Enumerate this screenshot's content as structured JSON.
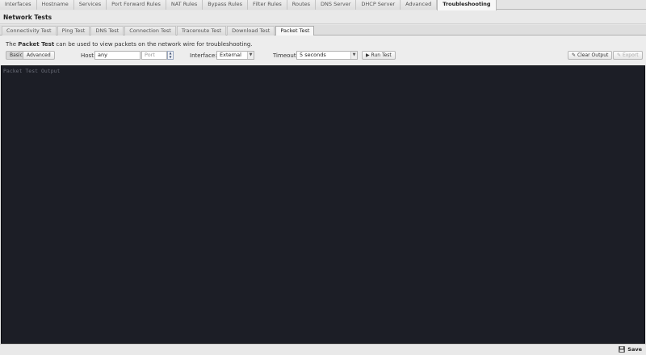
{
  "top_tabs": [
    "Interfaces",
    "Hostname",
    "Services",
    "Port Forward Rules",
    "NAT Rules",
    "Bypass Rules",
    "Filter Rules",
    "Routes",
    "DNS Server",
    "DHCP Server",
    "Advanced",
    "Troubleshooting"
  ],
  "active_top_tab": "Troubleshooting",
  "section_title": "Network Tests",
  "sub_tabs": [
    "Connectivity Test",
    "Ping Test",
    "DNS Test",
    "Connection Test",
    "Traceroute Test",
    "Download Test",
    "Packet Test"
  ],
  "active_sub_tab": "Packet Test",
  "description": {
    "prefix": "The ",
    "bold": "Packet Test",
    "suffix": " can be used to view packets on the network wire for troubleshooting."
  },
  "mode": {
    "basic": "Basic",
    "advanced": "Advanced",
    "selected": "Basic"
  },
  "host": {
    "label": "Host:",
    "value": "any",
    "port_placeholder": "Port"
  },
  "interface": {
    "label": "Interface:",
    "value": "External"
  },
  "timeout": {
    "label": "Timeout:",
    "value": "5 seconds"
  },
  "run_button": "Run Test",
  "clear_button": "Clear Output",
  "export_button": "Export",
  "output_placeholder": "Packet Test Output",
  "save_button": "Save"
}
